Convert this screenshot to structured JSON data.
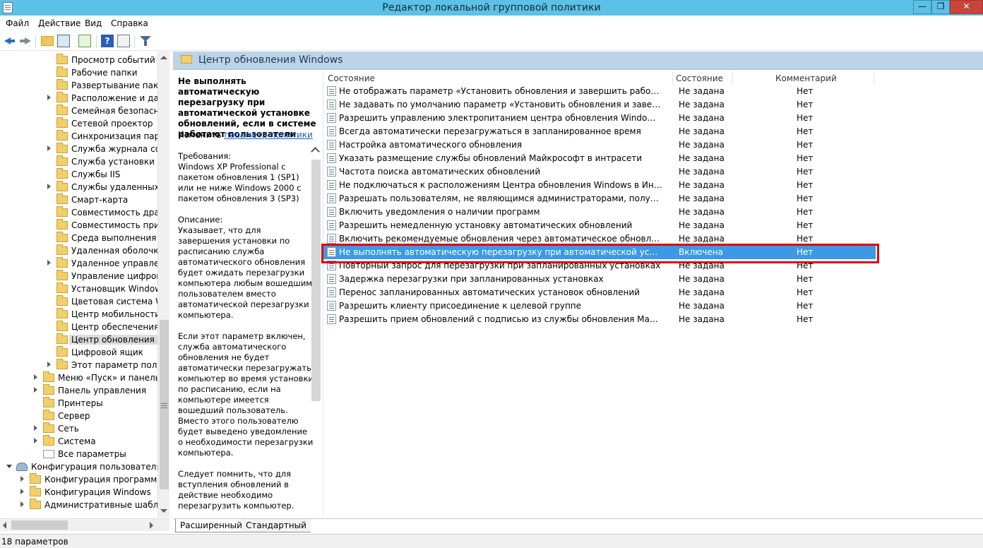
{
  "window": {
    "title": "Редактор локальной групповой политики",
    "min_glyph": "—",
    "max_glyph": "❐",
    "close_glyph": "✕"
  },
  "menu": [
    "Файл",
    "Действие",
    "Вид",
    "Справка"
  ],
  "toolbar": {
    "icons": [
      "back-arrow-icon",
      "forward-arrow-icon",
      "folder-up-icon",
      "show-hide-tree-icon",
      "export-list-icon",
      "help-icon",
      "properties-icon",
      "filter-icon"
    ],
    "help_glyph": "?"
  },
  "tree": [
    {
      "label": "Просмотр событий",
      "indent": 2,
      "expander": false,
      "icon": "folder"
    },
    {
      "label": "Рабочие папки",
      "indent": 2,
      "expander": false,
      "icon": "folder"
    },
    {
      "label": "Развертывание пакета",
      "indent": 2,
      "expander": false,
      "icon": "folder"
    },
    {
      "label": "Расположение и датчи",
      "indent": 2,
      "expander": true,
      "icon": "folder"
    },
    {
      "label": "Семейная безопасно",
      "indent": 2,
      "expander": false,
      "icon": "folder"
    },
    {
      "label": "Сетевой проектор",
      "indent": 2,
      "expander": false,
      "icon": "folder"
    },
    {
      "label": "Синхронизация парам",
      "indent": 2,
      "expander": false,
      "icon": "folder"
    },
    {
      "label": "Служба журнала собы",
      "indent": 2,
      "expander": true,
      "icon": "folder"
    },
    {
      "label": "Служба установки Act",
      "indent": 2,
      "expander": false,
      "icon": "folder"
    },
    {
      "label": "Службы IIS",
      "indent": 2,
      "expander": false,
      "icon": "folder"
    },
    {
      "label": "Службы удаленных ра",
      "indent": 2,
      "expander": true,
      "icon": "folder"
    },
    {
      "label": "Смарт-карта",
      "indent": 2,
      "expander": false,
      "icon": "folder"
    },
    {
      "label": "Совместимость драйв",
      "indent": 2,
      "expander": false,
      "icon": "folder"
    },
    {
      "label": "Совместимость прило",
      "indent": 2,
      "expander": false,
      "icon": "folder"
    },
    {
      "label": "Среда выполнения пр",
      "indent": 2,
      "expander": false,
      "icon": "folder"
    },
    {
      "label": "Удаленная оболочка W",
      "indent": 2,
      "expander": false,
      "icon": "folder"
    },
    {
      "label": "Удаленное управлени",
      "indent": 2,
      "expander": true,
      "icon": "folder"
    },
    {
      "label": "Управление цифровы",
      "indent": 2,
      "expander": false,
      "icon": "folder"
    },
    {
      "label": "Установщик Windows",
      "indent": 2,
      "expander": false,
      "icon": "folder"
    },
    {
      "label": "Цветовая система Win",
      "indent": 2,
      "expander": false,
      "icon": "folder"
    },
    {
      "label": "Центр мобильности W",
      "indent": 2,
      "expander": false,
      "icon": "folder"
    },
    {
      "label": "Центр обеспечения бе",
      "indent": 2,
      "expander": false,
      "icon": "folder"
    },
    {
      "label": "Центр обновления Wi",
      "indent": 2,
      "expander": false,
      "icon": "folder",
      "selected": true
    },
    {
      "label": "Цифровой ящик",
      "indent": 2,
      "expander": false,
      "icon": "folder"
    },
    {
      "label": "Этот параметр полити",
      "indent": 2,
      "expander": true,
      "icon": "folder"
    },
    {
      "label": "Меню «Пуск» и панель за",
      "indent": 1,
      "expander": true,
      "icon": "folder"
    },
    {
      "label": "Панель управления",
      "indent": 1,
      "expander": true,
      "icon": "folder"
    },
    {
      "label": "Принтеры",
      "indent": 1,
      "expander": false,
      "icon": "folder"
    },
    {
      "label": "Сервер",
      "indent": 1,
      "expander": false,
      "icon": "folder"
    },
    {
      "label": "Сеть",
      "indent": 1,
      "expander": true,
      "icon": "folder"
    },
    {
      "label": "Система",
      "indent": 1,
      "expander": true,
      "icon": "folder"
    },
    {
      "label": "Все параметры",
      "indent": 1,
      "expander": false,
      "icon": "doc"
    },
    {
      "label": "Конфигурация пользователя",
      "indent": 0,
      "expander": "down",
      "icon": "user"
    },
    {
      "label": "Конфигурация программ",
      "indent": 0.5,
      "expander": true,
      "icon": "folder"
    },
    {
      "label": "Конфигурация Windows",
      "indent": 0.5,
      "expander": true,
      "icon": "folder"
    },
    {
      "label": "Административные шаблоны",
      "indent": 0.5,
      "expander": true,
      "icon": "folder"
    }
  ],
  "header": {
    "title": "Центр обновления Windows"
  },
  "description": {
    "title": "Не выполнять автоматическую перезагрузку при автоматической установке обновлений, если в системе работают пользователи",
    "edit_prefix": "Изменить ",
    "edit_link": "параметр политики",
    "body": "Требования:\nWindows XP Professional с пакетом обновления 1 (SP1) или не ниже Windows 2000 с пакетом обновления 3 (SP3)\n\nОписание:\nУказывает, что для завершения установки по расписанию служба автоматического обновления будет ожидать перезагрузки компьютера любым вошедшим пользователем вместо автоматической перезагрузки компьютера.\n\nЕсли этот параметр включен, служба автоматического обновления не будет автоматически перезагружать компьютер во время установки по расписанию, если на компьютере имеется вошедший пользователь. Вместо этого пользователю будет выведено уведомление о необходимости перезагрузки компьютера.\n\nСледует помнить, что для вступления обновлений в действие необходимо перезагрузить компьютер.\n\nЕсли этот параметр отключен"
  },
  "columns": {
    "name": "Состояние",
    "state": "Состояние",
    "comment": "Комментарий"
  },
  "policies": [
    {
      "name": "Не отображать параметр «Установить обновления и завершить работу» в диало...",
      "state": "Не задана",
      "comment": "Нет"
    },
    {
      "name": "Не задавать по умолчанию параметр «Установить обновления и завершить раб...",
      "state": "Не задана",
      "comment": "Нет"
    },
    {
      "name": "Разрешить управлению электропитанием центра обновления Windows выводит...",
      "state": "Не задана",
      "comment": "Нет"
    },
    {
      "name": "Всегда автоматически перезагружаться в запланированное время",
      "state": "Не задана",
      "comment": "Нет"
    },
    {
      "name": "Настройка автоматического обновления",
      "state": "Не задана",
      "comment": "Нет"
    },
    {
      "name": "Указать размещение службы обновлений Майкрософт в интрасети",
      "state": "Не задана",
      "comment": "Нет"
    },
    {
      "name": "Частота поиска автоматических обновлений",
      "state": "Не задана",
      "comment": "Нет"
    },
    {
      "name": "Не подключаться к расположениям Центра обновления Windows в Интернете",
      "state": "Не задана",
      "comment": "Нет"
    },
    {
      "name": "Разрешать пользователям, не являющимся администраторами, получать уведо...",
      "state": "Не задана",
      "comment": "Нет"
    },
    {
      "name": "Включить уведомления о наличии программ",
      "state": "Не задана",
      "comment": "Нет"
    },
    {
      "name": "Разрешить немедленную установку автоматических обновлений",
      "state": "Не задана",
      "comment": "Нет"
    },
    {
      "name": "Включить рекомендуемые обновления через автоматическое обновление",
      "state": "Не задана",
      "comment": "Нет"
    },
    {
      "name": "Не выполнять автоматическую перезагрузку при автоматической установке обн...",
      "state": "Включена",
      "comment": "Нет",
      "selected": true
    },
    {
      "name": "Повторный запрос для перезагрузки при запланированных установках",
      "state": "Не задана",
      "comment": "Нет"
    },
    {
      "name": "Задержка перезагрузки при запланированных установках",
      "state": "Не задана",
      "comment": "Нет"
    },
    {
      "name": "Перенос запланированных автоматических установок обновлений",
      "state": "Не задана",
      "comment": "Нет"
    },
    {
      "name": "Разрешить клиенту присоединение к целевой группе",
      "state": "Не задана",
      "comment": "Нет"
    },
    {
      "name": "Разрешить прием обновлений с подписью из службы обновления Майкрософт ...",
      "state": "Не задана",
      "comment": "Нет"
    }
  ],
  "tabs": [
    "Расширенный",
    "Стандартный"
  ],
  "status": {
    "text": "18 параметров"
  },
  "colors": {
    "titlebar": "#5bc1e6",
    "selection": "#3c99e5",
    "highlight": "#e00000",
    "header_strip": "#bcd3e8"
  }
}
